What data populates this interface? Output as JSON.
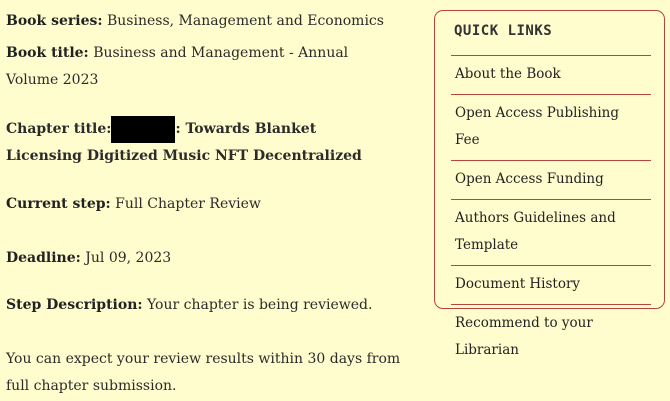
{
  "book": {
    "series_label": "Book series:",
    "series_value": "Business, Management and Economics",
    "title_label": "Book title:",
    "title_value_line1": "Business and Management - Annual",
    "title_value_line2": "Volume 2023"
  },
  "chapter": {
    "label": "Chapter title:",
    "title_suffix": ": Towards Blanket",
    "title_line2": "Licensing Digitized Music NFT Decentralized"
  },
  "step": {
    "label": "Current step:",
    "value": "Full Chapter Review"
  },
  "deadline": {
    "label": "Deadline:",
    "value": "Jul 09, 2023"
  },
  "description": {
    "label": "Step Description:",
    "value": "Your chapter is being reviewed.",
    "note_line1": "You can expect your review results within 30 days from",
    "note_line2": "full chapter submission."
  },
  "sidebar": {
    "heading": "QUICK LINKS",
    "links": [
      {
        "label": "About the Book"
      },
      {
        "label": "Open Access Publishing Fee"
      },
      {
        "label": "Open Access Funding"
      },
      {
        "label": "Authors Guidelines and Template"
      },
      {
        "label": "Document History"
      },
      {
        "label": "Recommend to your Librarian"
      }
    ],
    "accent_color": "#b8453d",
    "background_color": "#fffccd"
  }
}
